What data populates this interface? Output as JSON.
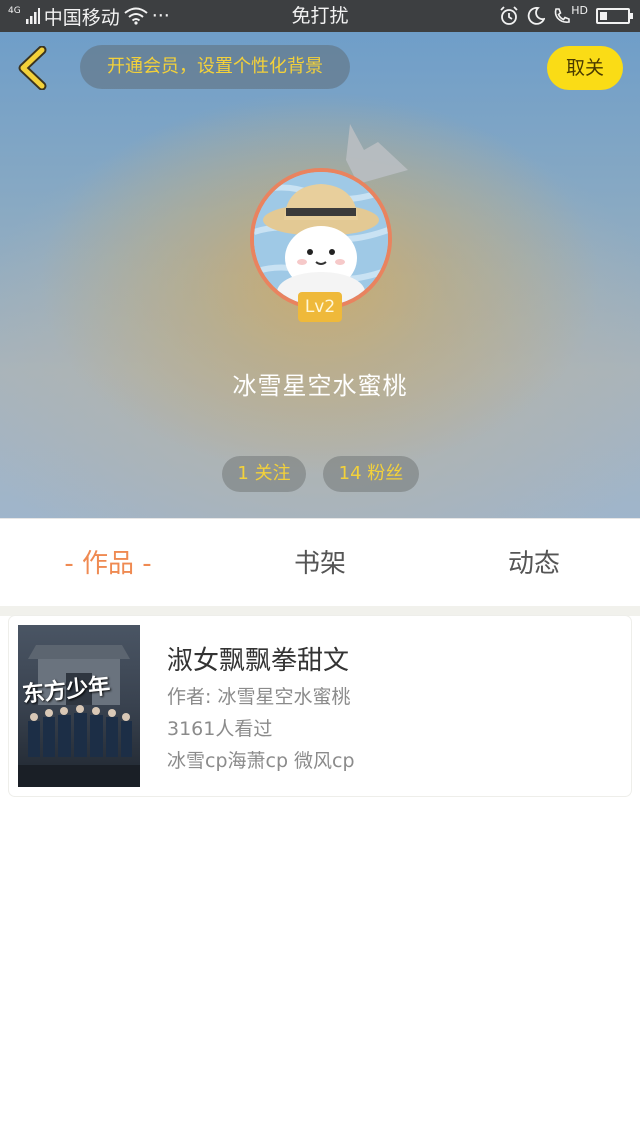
{
  "status_bar": {
    "signal_label": "4G",
    "carrier": "中国移动",
    "more": "···",
    "center_text": "免打扰",
    "hd_label": "HD",
    "battery_level": 0.25
  },
  "header": {
    "vip_prompt": "开通会员，设置个性化背景",
    "unfollow_label": "取关",
    "level": "Lv2",
    "username": "冰雪星空水蜜桃",
    "following": "1 关注",
    "fans": "14 粉丝"
  },
  "tabs": [
    {
      "label": "- 作品 -",
      "active": true
    },
    {
      "label": "书架",
      "active": false
    },
    {
      "label": "动态",
      "active": false
    }
  ],
  "books": [
    {
      "title": "淑女飘飘拳甜文",
      "author": "作者: 冰雪星空水蜜桃",
      "views": "3161人看过",
      "tags": "冰雪cp海萧cp 微风cp",
      "cover_text": "东方少年"
    }
  ],
  "colors": {
    "accent": "#ef8a52",
    "gold": "#f3d13a",
    "unfollow_bg": "#fadc16",
    "status_bar_bg": "#3d3f41"
  }
}
